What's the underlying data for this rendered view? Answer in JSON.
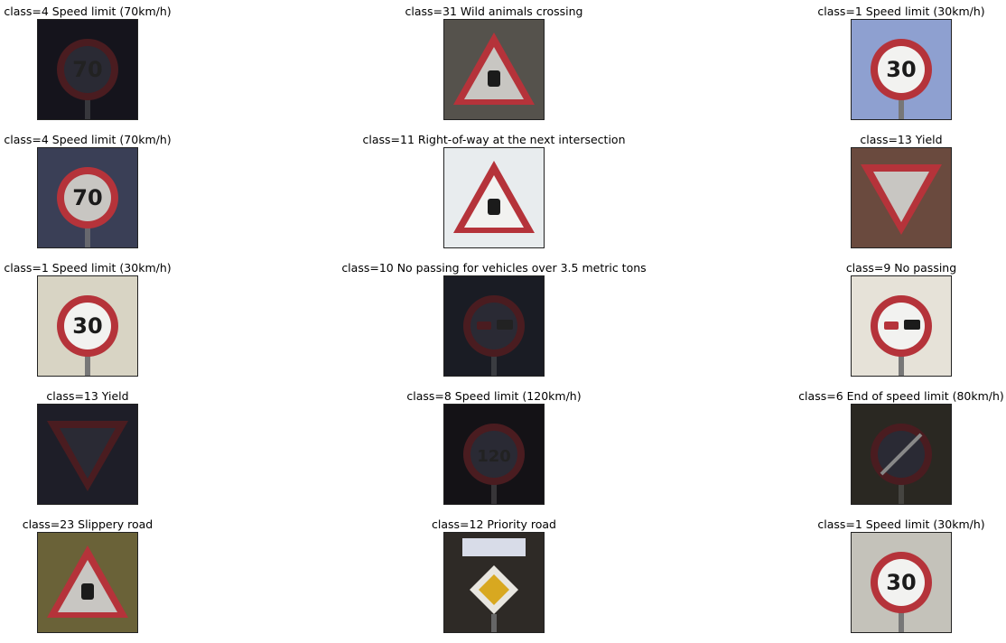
{
  "grid": [
    [
      {
        "label": "class=4 Speed limit (70km/h)",
        "sign": "speed",
        "text": "70",
        "bg": "#15141c",
        "tone": "dark"
      },
      {
        "label": "class=31 Wild animals crossing",
        "sign": "triangle",
        "text": "",
        "bg": "#55524c",
        "tone": "mid"
      },
      {
        "label": "class=1 Speed limit (30km/h)",
        "sign": "speed",
        "text": "30",
        "bg": "#8ea0d0",
        "tone": "light"
      }
    ],
    [
      {
        "label": "class=4 Speed limit (70km/h)",
        "sign": "speed",
        "text": "70",
        "bg": "#3a3f56",
        "tone": "mid"
      },
      {
        "label": "class=11 Right-of-way at the next intersection",
        "sign": "triangle",
        "text": "",
        "bg": "#e8ecee",
        "tone": "bright"
      },
      {
        "label": "class=13 Yield",
        "sign": "yield",
        "text": "",
        "bg": "#6a4a3e",
        "tone": "mid"
      }
    ],
    [
      {
        "label": "class=1 Speed limit (30km/h)",
        "sign": "speed",
        "text": "30",
        "bg": "#d8d4c4",
        "tone": "bright"
      },
      {
        "label": "class=10 No passing for vehicles over 3.5 metric tons",
        "sign": "nopass",
        "text": "",
        "bg": "#1a1c24",
        "tone": "dark"
      },
      {
        "label": "class=9 No passing",
        "sign": "nopass",
        "text": "",
        "bg": "#e6e2d8",
        "tone": "bright"
      }
    ],
    [
      {
        "label": "class=13 Yield",
        "sign": "yield",
        "text": "",
        "bg": "#1e1e28",
        "tone": "dark"
      },
      {
        "label": "class=8 Speed limit (120km/h)",
        "sign": "speed",
        "text": "120",
        "bg": "#141216",
        "tone": "dark"
      },
      {
        "label": "class=6 End of speed limit (80km/h)",
        "sign": "end",
        "text": "",
        "bg": "#2a2822",
        "tone": "dark"
      }
    ],
    [
      {
        "label": "class=23 Slippery road",
        "sign": "triangle",
        "text": "",
        "bg": "#6a6238",
        "tone": "mid"
      },
      {
        "label": "class=12 Priority road",
        "sign": "priority",
        "text": "",
        "bg": "#2e2a26",
        "tone": "dark"
      },
      {
        "label": "class=1 Speed limit (30km/h)",
        "sign": "speed",
        "text": "30",
        "bg": "#c4c2ba",
        "tone": "bright"
      }
    ]
  ]
}
